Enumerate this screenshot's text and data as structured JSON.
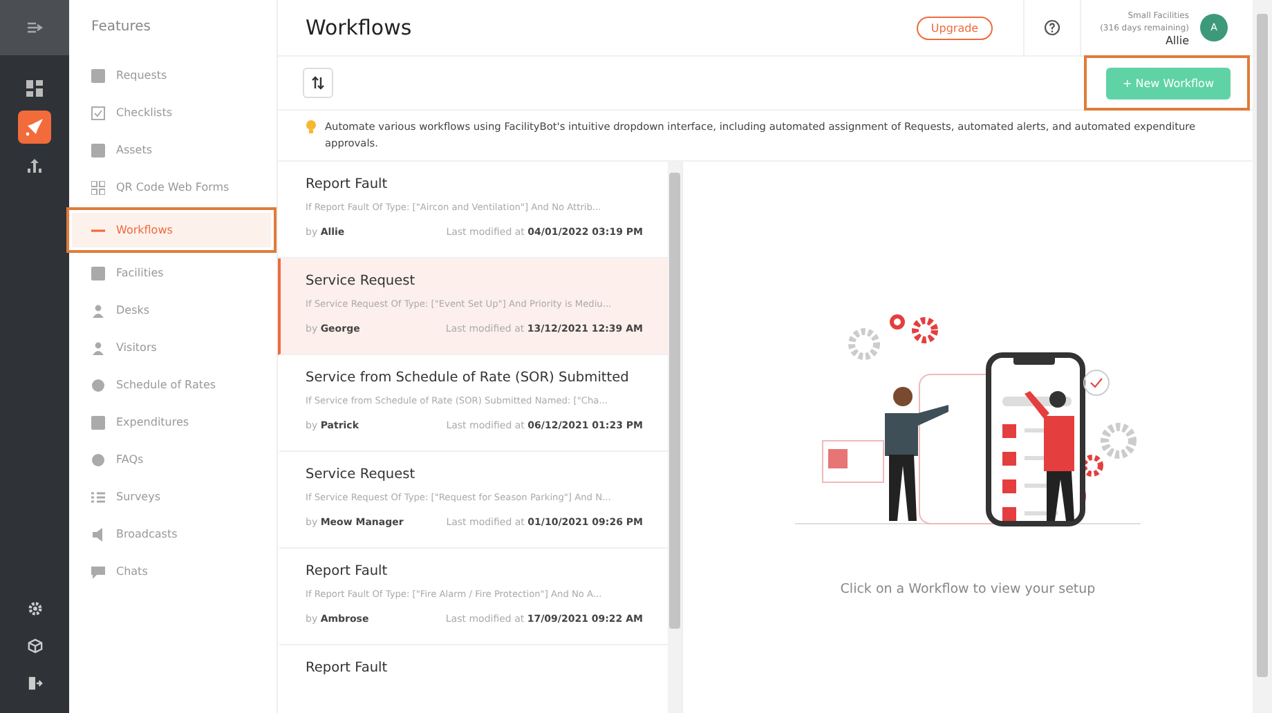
{
  "features": {
    "title": "Features",
    "items": [
      {
        "label": "Requests",
        "selected": false,
        "annotated": false
      },
      {
        "label": "Checklists",
        "selected": false,
        "annotated": false
      },
      {
        "label": "Assets",
        "selected": false,
        "annotated": false
      },
      {
        "label": "QR Code Web Forms",
        "selected": false,
        "annotated": false
      },
      {
        "label": "Workflows",
        "selected": true,
        "annotated": true
      },
      {
        "label": "Facilities",
        "selected": false,
        "annotated": false
      },
      {
        "label": "Desks",
        "selected": false,
        "annotated": false
      },
      {
        "label": "Visitors",
        "selected": false,
        "annotated": false
      },
      {
        "label": "Schedule of Rates",
        "selected": false,
        "annotated": false
      },
      {
        "label": "Expenditures",
        "selected": false,
        "annotated": false
      },
      {
        "label": "FAQs",
        "selected": false,
        "annotated": false
      },
      {
        "label": "Surveys",
        "selected": false,
        "annotated": false
      },
      {
        "label": "Broadcasts",
        "selected": false,
        "annotated": false
      },
      {
        "label": "Chats",
        "selected": false,
        "annotated": false
      }
    ]
  },
  "rail": {
    "items": [
      {
        "selected": false
      },
      {
        "selected": true
      },
      {
        "selected": false
      }
    ]
  },
  "header": {
    "title": "Workflows",
    "upgrade": "Upgrade",
    "plan": "Small Facilities",
    "remaining": "(316 days remaining)",
    "user": "Allie",
    "avatar": "A"
  },
  "toolbar": {
    "new_button": "+ New Workflow",
    "new_annotated": true
  },
  "info": "Automate various workflows using FacilityBot's intuitive dropdown interface, including automated assignment of Requests, automated alerts, and automated expenditure approvals.",
  "workflows": [
    {
      "title": "Report Fault",
      "condition": "If Report Fault Of Type: [\"Aircon and Ventilation\"] And No Attrib...",
      "by": "by",
      "author": "Allie",
      "modified_label": "Last modified at",
      "modified": "04/01/2022 03:19 PM",
      "selected": false
    },
    {
      "title": "Service Request",
      "condition": "If Service Request Of Type: [\"Event Set Up\"] And Priority is Mediu...",
      "by": "by",
      "author": "George",
      "modified_label": "Last modified at",
      "modified": "13/12/2021 12:39 AM",
      "selected": true
    },
    {
      "title": "Service from Schedule of Rate (SOR) Submitted",
      "condition": "If Service from Schedule of Rate (SOR) Submitted Named: [\"Cha...",
      "by": "by",
      "author": "Patrick",
      "modified_label": "Last modified at",
      "modified": "06/12/2021 01:23 PM",
      "selected": false
    },
    {
      "title": "Service Request",
      "condition": "If Service Request Of Type: [\"Request for Season Parking\"] And N...",
      "by": "by",
      "author": "Meow Manager",
      "modified_label": "Last modified at",
      "modified": "01/10/2021 09:26 PM",
      "selected": false
    },
    {
      "title": "Report Fault",
      "condition": "If Report Fault Of Type: [\"Fire Alarm / Fire Protection\"] And No A...",
      "by": "by",
      "author": "Ambrose",
      "modified_label": "Last modified at",
      "modified": "17/09/2021 09:22 AM",
      "selected": false
    },
    {
      "title": "Report Fault",
      "selected": false
    }
  ],
  "detail": {
    "hint": "Click on a Workflow to view your setup"
  }
}
